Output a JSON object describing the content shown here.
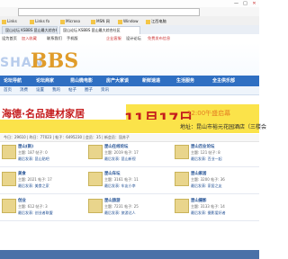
{
  "browser": {
    "window_buttons": [
      "—",
      "□",
      "✕"
    ],
    "bookmarks": [
      "Links",
      "Links fo",
      "Microso",
      "MSN 网",
      "Window",
      "江西电脑"
    ],
    "tabs": [
      "昆山论坛 KSBBS 昆山最大综合社区",
      "昆山论坛 KSBBS 昆山最大综合社区"
    ]
  },
  "site": {
    "top_links": [
      "设为首页",
      "加入收藏",
      "联系我们",
      "手机版",
      "企业客服",
      "设计论坛",
      "免费发布信息"
    ],
    "logo_shan": "SHAN",
    "logo_bbs": "BBS",
    "nav": [
      "论坛导航",
      "论坛商家",
      "昆山微电影",
      "房产大家谈",
      "新鲜速递",
      "生活服务",
      "全主供乐部"
    ],
    "subnav": [
      "首页",
      "消费",
      "设置",
      "我的",
      "帖子",
      "圈子",
      "资讯"
    ],
    "ad": {
      "brand": "海德·名品建材家居",
      "date": "11月17日",
      "time": "12:00午盛启幕",
      "address": "地址：昆山市裕元花园酒店（三楼会"
    },
    "stats": "今日：29610 | 昨日：77023 | 帖子：6495230 | 会员：35 | 新会员：昆苏子"
  },
  "forums": [
    {
      "title": "昆山(新)",
      "stat": "主题: 187  帖子: 0",
      "last": "最后发表: 昆山贴吧"
    },
    {
      "title": "昆山在线论坛",
      "stat": "主题: 2019  帖子: 17",
      "last": "最后发表: 昆山新视"
    },
    {
      "title": "昆山百业论坛",
      "stat": "主题: 121  帖子: 8",
      "last": "最后发表: 百业一起"
    },
    {
      "title": "美食",
      "stat": "主题: 2021  帖子: 17",
      "last": "最后发表: 美食之家"
    },
    {
      "title": "昆山车坛",
      "stat": "主题: 3161  帖子: 11",
      "last": "最后发表: 车友小李"
    },
    {
      "title": "昆山家居",
      "stat": "主题: 3200  帖子: 36",
      "last": "最后发表: 家居之友"
    },
    {
      "title": "创业",
      "stat": "主题: 612  帖子: 3",
      "last": "最后发表: 创业者联盟"
    },
    {
      "title": "昆山旅游",
      "stat": "主题: 7231  帖子: 25",
      "last": "最后发表: 旅游达人"
    },
    {
      "title": "昆山摄影",
      "stat": "主题: 3133  帖子: 14",
      "last": "最后发表: 摄影爱好者"
    }
  ]
}
